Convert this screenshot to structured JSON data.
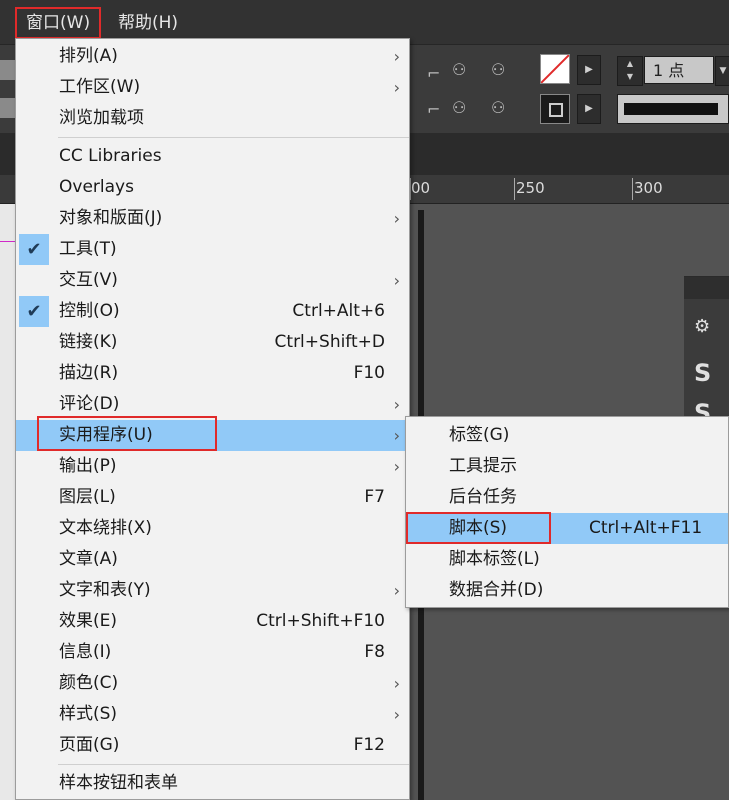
{
  "menubar": {
    "window": "窗口(W)",
    "help": "帮助(H)"
  },
  "controlbar": {
    "stroke_weight": "1 点"
  },
  "ruler": {
    "ticks": [
      "00",
      "250",
      "300"
    ]
  },
  "window_menu": {
    "items": [
      {
        "label": "排列(A)",
        "shortcut": "",
        "submenu": true,
        "checked": false
      },
      {
        "label": "工作区(W)",
        "shortcut": "",
        "submenu": true,
        "checked": false
      },
      {
        "label": "浏览加载项",
        "shortcut": "",
        "submenu": false,
        "checked": false
      },
      {
        "label": "CC Libraries",
        "shortcut": "",
        "submenu": false,
        "checked": false
      },
      {
        "label": "Overlays",
        "shortcut": "",
        "submenu": false,
        "checked": false
      },
      {
        "label": "对象和版面(J)",
        "shortcut": "",
        "submenu": true,
        "checked": false
      },
      {
        "label": "工具(T)",
        "shortcut": "",
        "submenu": false,
        "checked": true
      },
      {
        "label": "交互(V)",
        "shortcut": "",
        "submenu": true,
        "checked": false
      },
      {
        "label": "控制(O)",
        "shortcut": "Ctrl+Alt+6",
        "submenu": false,
        "checked": true
      },
      {
        "label": "链接(K)",
        "shortcut": "Ctrl+Shift+D",
        "submenu": false,
        "checked": false
      },
      {
        "label": "描边(R)",
        "shortcut": "F10",
        "submenu": false,
        "checked": false
      },
      {
        "label": "评论(D)",
        "shortcut": "",
        "submenu": true,
        "checked": false
      },
      {
        "label": "实用程序(U)",
        "shortcut": "",
        "submenu": true,
        "checked": false
      },
      {
        "label": "输出(P)",
        "shortcut": "",
        "submenu": true,
        "checked": false
      },
      {
        "label": "图层(L)",
        "shortcut": "F7",
        "submenu": false,
        "checked": false
      },
      {
        "label": "文本绕排(X)",
        "shortcut": "",
        "submenu": false,
        "checked": false
      },
      {
        "label": "文章(A)",
        "shortcut": "",
        "submenu": false,
        "checked": false
      },
      {
        "label": "文字和表(Y)",
        "shortcut": "",
        "submenu": true,
        "checked": false
      },
      {
        "label": "效果(E)",
        "shortcut": "Ctrl+Shift+F10",
        "submenu": false,
        "checked": false
      },
      {
        "label": "信息(I)",
        "shortcut": "F8",
        "submenu": false,
        "checked": false
      },
      {
        "label": "颜色(C)",
        "shortcut": "",
        "submenu": true,
        "checked": false
      },
      {
        "label": "样式(S)",
        "shortcut": "",
        "submenu": true,
        "checked": false
      },
      {
        "label": "页面(G)",
        "shortcut": "F12",
        "submenu": false,
        "checked": false
      },
      {
        "label": "样本按钮和表单",
        "shortcut": "",
        "submenu": false,
        "checked": false
      }
    ]
  },
  "utilities_submenu": {
    "items": [
      {
        "label": "标签(G)",
        "shortcut": ""
      },
      {
        "label": "工具提示",
        "shortcut": ""
      },
      {
        "label": "后台任务",
        "shortcut": ""
      },
      {
        "label": "脚本(S)",
        "shortcut": "Ctrl+Alt+F11"
      },
      {
        "label": "脚本标签(L)",
        "shortcut": ""
      },
      {
        "label": "数据合并(D)",
        "shortcut": ""
      }
    ]
  },
  "icons": {
    "submenu_arrow": "chevron-right-icon",
    "check": "checkmark-icon"
  },
  "colors": {
    "highlight": "#91c9f7",
    "callout_red": "#e02a2a",
    "menubar": "#323232"
  }
}
